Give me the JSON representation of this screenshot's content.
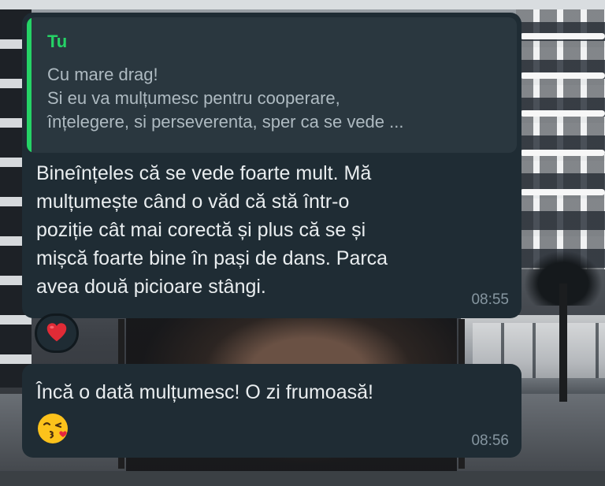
{
  "reply_message": {
    "quoted": {
      "author": "Tu",
      "text": "Cu mare drag!\nSi eu va mulțumesc pentru cooperare,\nînțelegere, si perseverenta, sper ca se vede ..."
    },
    "text": "Bineînțeles că se vede foarte mult. Mă\nmulțumește când o văd că stă într-o\npoziție cât mai corectă și plus că se și\nmișcă foarte bine în pași de dans. Parca\navea două picioare stângi.",
    "time": "08:55",
    "reaction": "heart-icon"
  },
  "thanks_message": {
    "text": "Încă o dată mulțumesc! O zi frumoasă!",
    "emoji": "kissing-face-with-heart-icon",
    "time": "08:56"
  },
  "colors": {
    "bubble": "#1f2c34",
    "quote_accent": "#25d366",
    "timestamp": "#8696a0",
    "heart": "#e02b36"
  }
}
